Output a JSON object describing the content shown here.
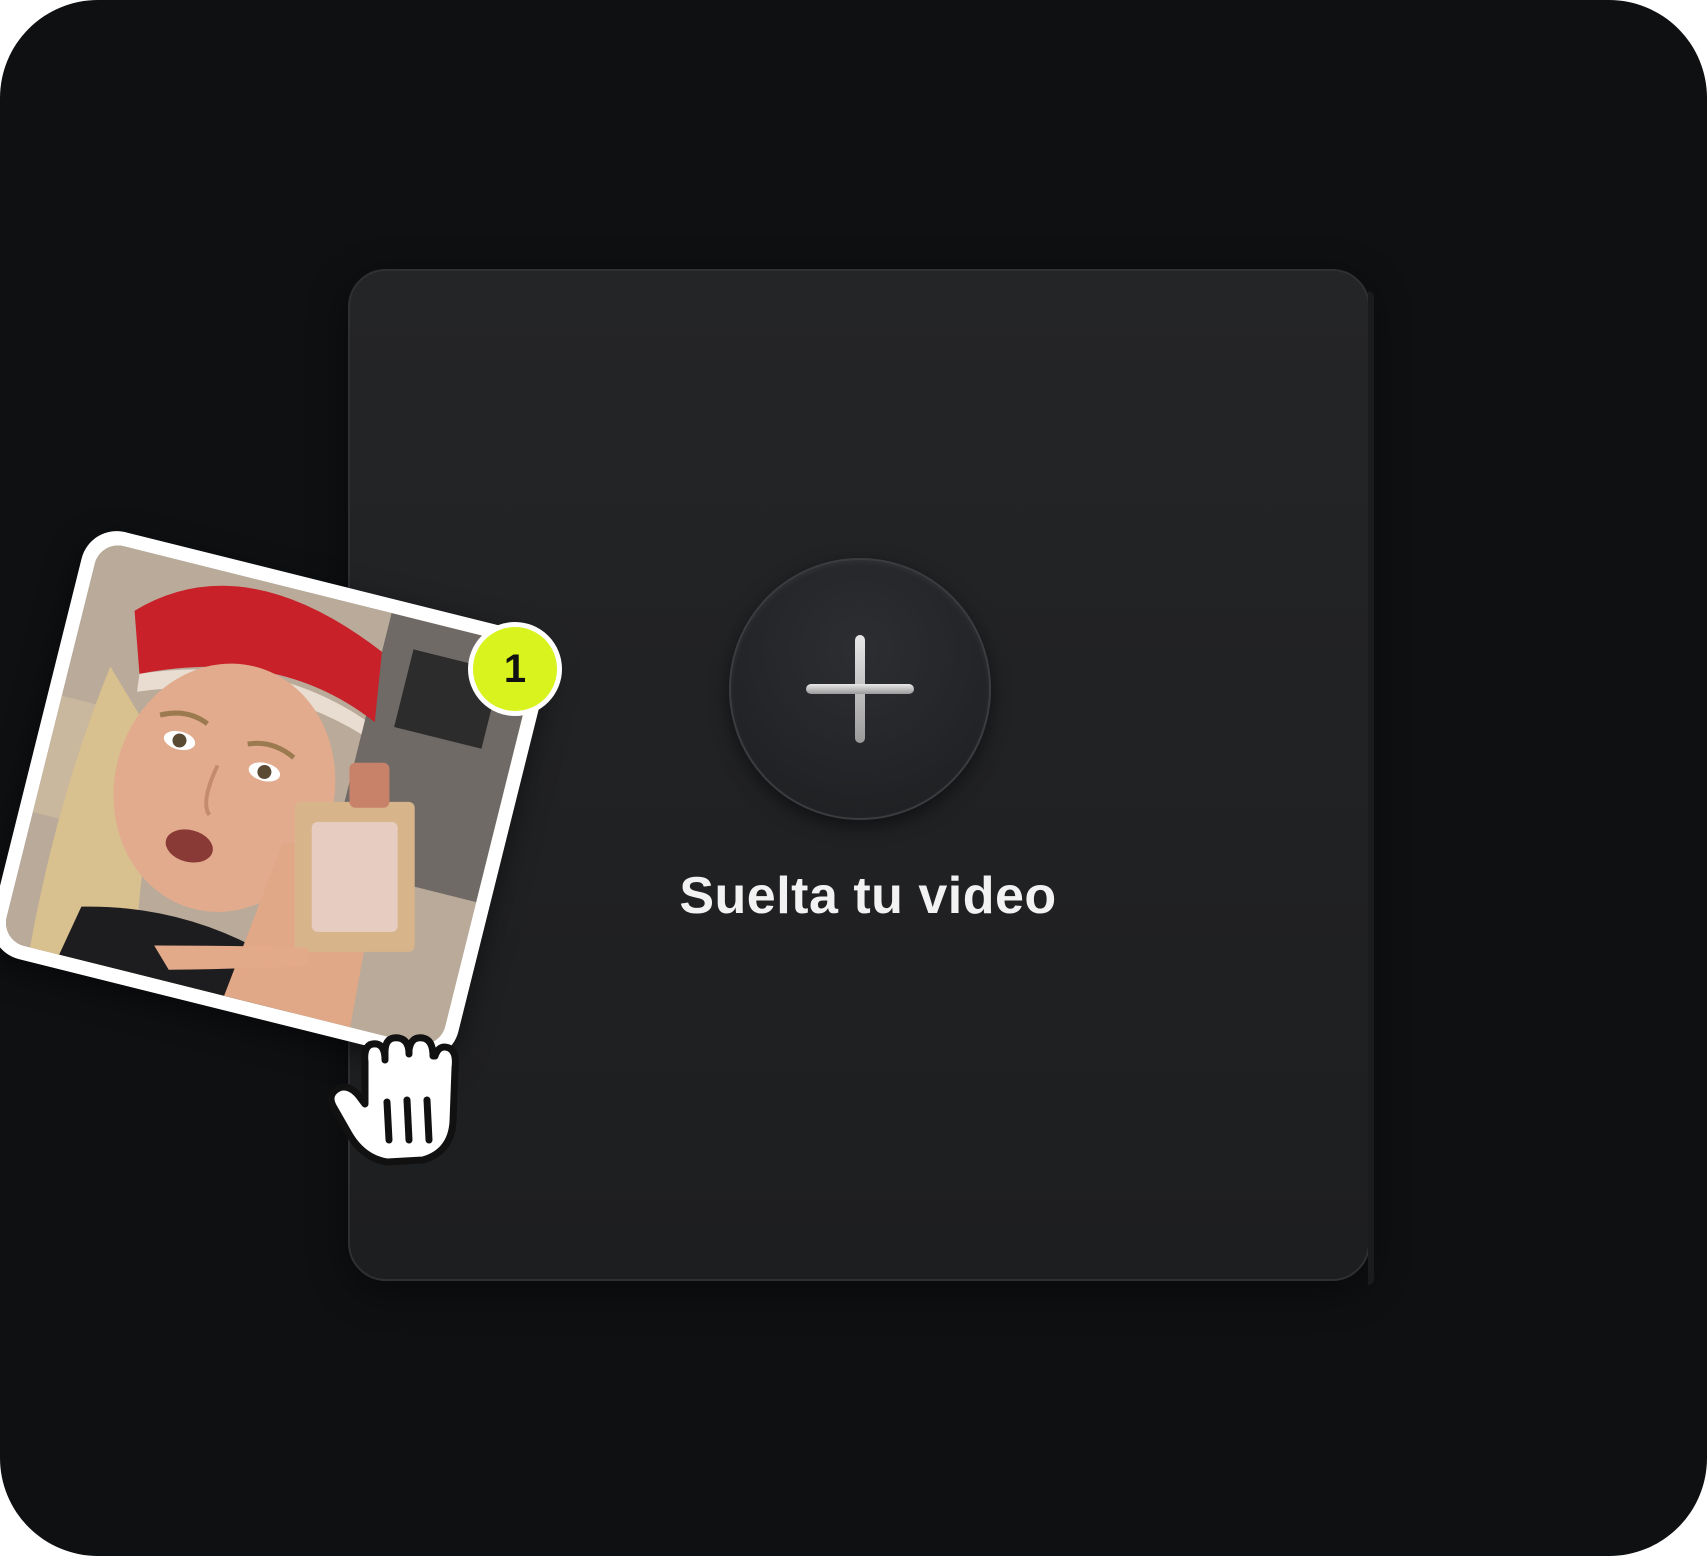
{
  "dropzone": {
    "label": "Suelta tu video",
    "add_icon": "plus-icon"
  },
  "dragged_item": {
    "thumbnail": "video-thumbnail-woman-with-red-cap-holding-perfume-bottle",
    "count_badge": "1"
  },
  "cursor": {
    "icon": "grab-hand-icon"
  },
  "colors": {
    "background": "#0f1012",
    "panel": "#222325",
    "badge": "#d8f31d",
    "text": "#f2f2f2"
  }
}
